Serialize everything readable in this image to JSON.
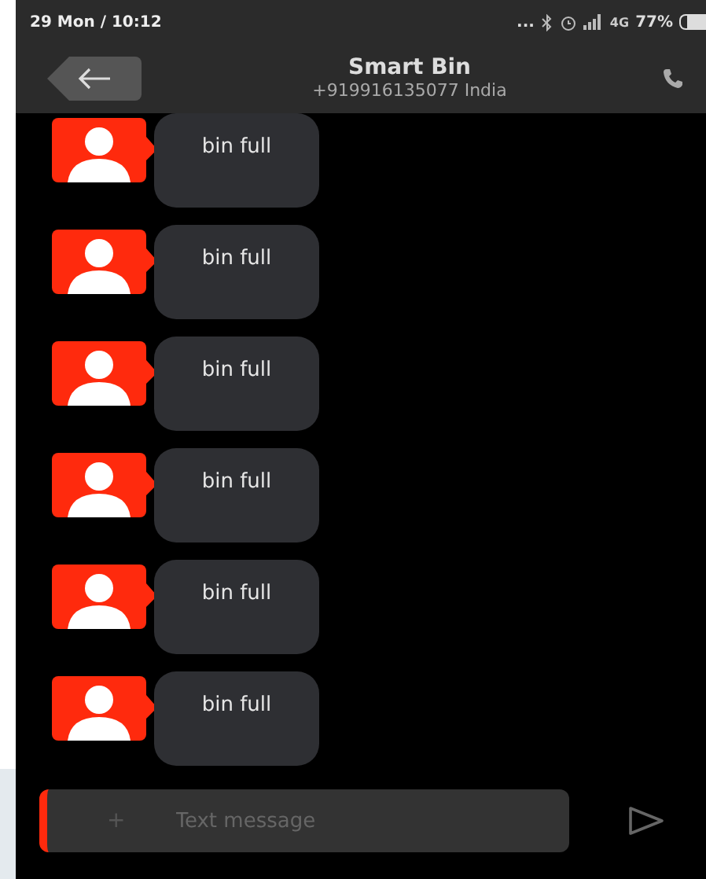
{
  "status_bar": {
    "time": "29 Mon / 10:12",
    "dots": "...",
    "network": "4G",
    "battery": "77%"
  },
  "header": {
    "title": "Smart Bin",
    "subtitle": "+919916135077 India"
  },
  "messages": [
    {
      "text": "bin full"
    },
    {
      "text": "bin full"
    },
    {
      "text": "bin full"
    },
    {
      "text": "bin full"
    },
    {
      "text": "bin full"
    },
    {
      "text": "bin full"
    }
  ],
  "composer": {
    "placeholder": "Text message",
    "attach": "+"
  }
}
